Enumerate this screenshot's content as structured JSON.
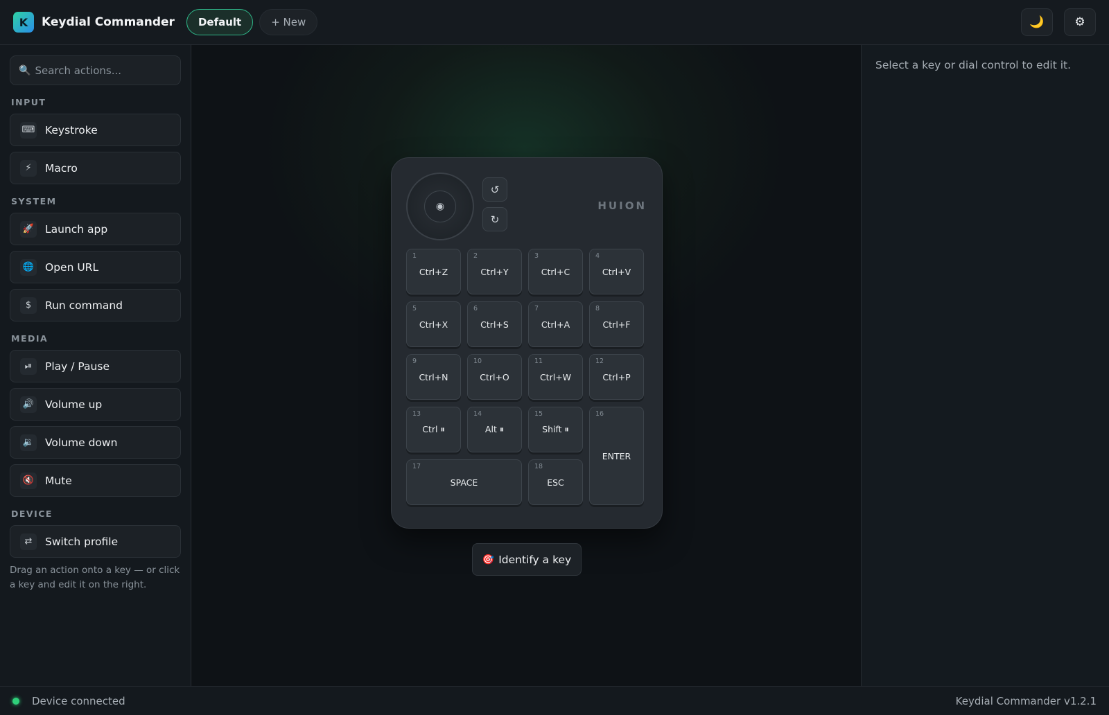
{
  "header": {
    "logo_letter": "K",
    "title": "Keydial Commander",
    "profiles": [
      {
        "label": "Default",
        "active": true
      }
    ],
    "new_profile_label": "+ New",
    "theme_icon": "moon-icon",
    "settings_icon": "gear-icon",
    "accent_color": "#2fb88a"
  },
  "sidebar": {
    "search": {
      "placeholder": "Search actions...",
      "value": ""
    },
    "groups": [
      {
        "label": "INPUT",
        "items": [
          {
            "icon": "⌨",
            "icon_name": "keyboard-icon",
            "label": "Keystroke"
          },
          {
            "icon": "⚡",
            "icon_name": "lightning-icon",
            "label": "Macro"
          }
        ]
      },
      {
        "label": "SYSTEM",
        "items": [
          {
            "icon": "🚀",
            "icon_name": "rocket-icon",
            "label": "Launch app"
          },
          {
            "icon": "🌐",
            "icon_name": "globe-icon",
            "label": "Open URL"
          },
          {
            "icon": "$",
            "icon_name": "terminal-icon",
            "label": "Run command"
          }
        ]
      },
      {
        "label": "MEDIA",
        "items": [
          {
            "icon": "⏯",
            "icon_name": "play-pause-icon",
            "label": "Play / Pause"
          },
          {
            "icon": "🔊",
            "icon_name": "volume-up-icon",
            "label": "Volume up"
          },
          {
            "icon": "🔉",
            "icon_name": "volume-down-icon",
            "label": "Volume down"
          },
          {
            "icon": "🔇",
            "icon_name": "mute-icon",
            "label": "Mute"
          }
        ]
      },
      {
        "label": "DEVICE",
        "items": [
          {
            "icon": "⇄",
            "icon_name": "switch-icon",
            "label": "Switch profile"
          }
        ]
      }
    ],
    "hint": "Drag an action onto a key — or click a key and edit it on the right."
  },
  "device": {
    "brand": "HUION",
    "dial_center_icon": "◉",
    "rotate_ccw_icon": "↺",
    "rotate_cw_icon": "↻",
    "keys": [
      {
        "num": "1",
        "label": "Ctrl+Z"
      },
      {
        "num": "2",
        "label": "Ctrl+Y"
      },
      {
        "num": "3",
        "label": "Ctrl+C"
      },
      {
        "num": "4",
        "label": "Ctrl+V"
      },
      {
        "num": "5",
        "label": "Ctrl+X"
      },
      {
        "num": "6",
        "label": "Ctrl+S"
      },
      {
        "num": "7",
        "label": "Ctrl+A"
      },
      {
        "num": "8",
        "label": "Ctrl+F"
      },
      {
        "num": "9",
        "label": "Ctrl+N"
      },
      {
        "num": "10",
        "label": "Ctrl+O"
      },
      {
        "num": "11",
        "label": "Ctrl+W"
      },
      {
        "num": "12",
        "label": "Ctrl+P"
      },
      {
        "num": "13",
        "label": "Ctrl ⏸"
      },
      {
        "num": "14",
        "label": "Alt ⏸"
      },
      {
        "num": "15",
        "label": "Shift ⏸"
      },
      {
        "num": "16",
        "label": "ENTER"
      },
      {
        "num": "17",
        "label": "SPACE"
      },
      {
        "num": "18",
        "label": "ESC"
      }
    ],
    "identify_label": "Identify a key",
    "identify_icon": "🎯"
  },
  "inspector": {
    "empty_text": "Select a key or dial control to edit it."
  },
  "status": {
    "connection": "Device connected",
    "connection_color": "#2fcf7a",
    "version": "Keydial Commander v1.2.1"
  }
}
